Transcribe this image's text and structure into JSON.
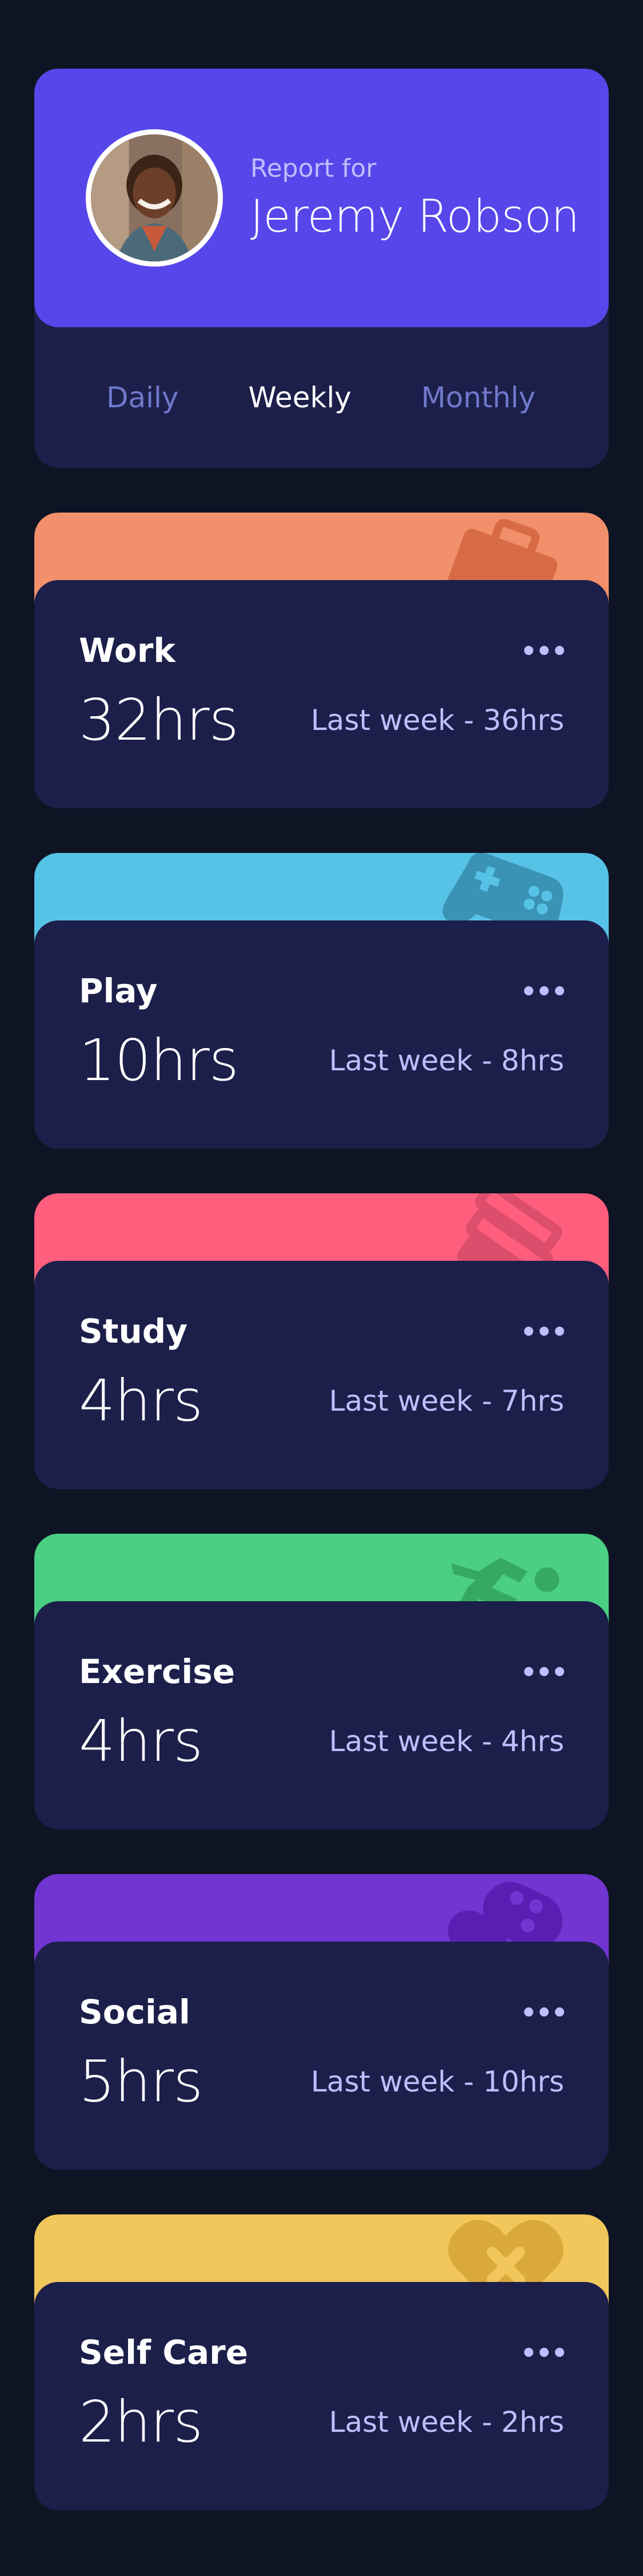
{
  "profile": {
    "report_for": "Report for",
    "name": "Jeremy Robson"
  },
  "timeframes": [
    {
      "label": "Daily",
      "active": false
    },
    {
      "label": "Weekly",
      "active": true
    },
    {
      "label": "Monthly",
      "active": false
    }
  ],
  "activities": [
    {
      "title": "Work",
      "hours": "32hrs",
      "previous": "Last week - 36hrs",
      "color": "#f1906b",
      "icon_color": "#d86b47",
      "icon": "briefcase-icon"
    },
    {
      "title": "Play",
      "hours": "10hrs",
      "previous": "Last week - 8hrs",
      "color": "#56c2e6",
      "icon_color": "#3a92b5",
      "icon": "gamepad-icon"
    },
    {
      "title": "Study",
      "hours": "4hrs",
      "previous": "Last week - 7hrs",
      "color": "#ff5e7d",
      "icon_color": "#dc4e6c",
      "icon": "books-icon"
    },
    {
      "title": "Exercise",
      "hours": "4hrs",
      "previous": "Last week - 4hrs",
      "color": "#4bcf82",
      "icon_color": "#35a964",
      "icon": "running-icon"
    },
    {
      "title": "Social",
      "hours": "5hrs",
      "previous": "Last week - 10hrs",
      "color": "#7235d1",
      "icon_color": "#5a1fb2",
      "icon": "social-icon"
    },
    {
      "title": "Self Care",
      "hours": "2hrs",
      "previous": "Last week - 2hrs",
      "color": "#f1c75b",
      "icon_color": "#d9a93a",
      "icon": "heart-cross-icon"
    }
  ]
}
